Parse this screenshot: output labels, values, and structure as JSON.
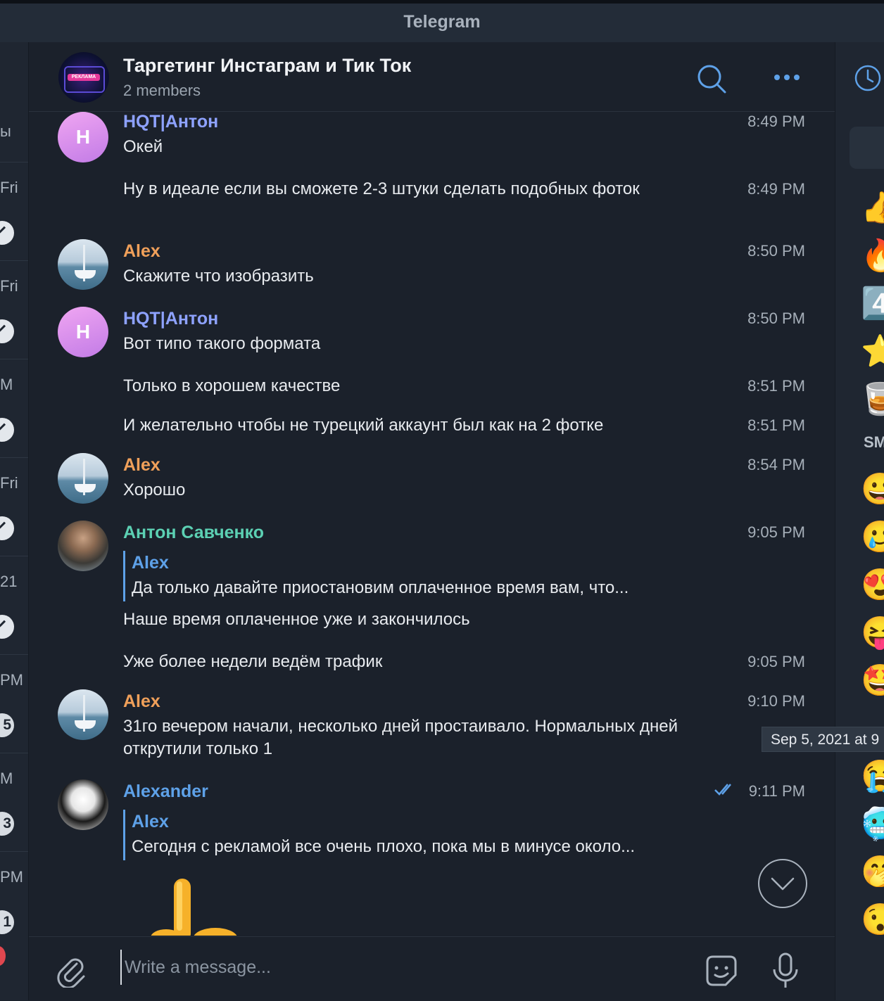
{
  "window": {
    "title": "Telegram"
  },
  "left_column": {
    "items": [
      {
        "text": "ы"
      },
      {
        "text": "Fri"
      },
      {
        "text": "Fri"
      },
      {
        "text": "M"
      },
      {
        "text": "Fri"
      },
      {
        "text": "21"
      },
      {
        "text": "PM"
      },
      {
        "text": "M"
      },
      {
        "text": "PM"
      }
    ],
    "badges": [
      "5",
      "3",
      "1"
    ]
  },
  "header": {
    "title": "Таргетинг Инстаграм и Тик Ток",
    "subtitle": "2 members",
    "avatar_text": "РЕКЛАМА"
  },
  "messages": [
    {
      "sender": "HQT|Антон",
      "sender_color": "#8ea2ff",
      "avatar": "H",
      "text": "Окей",
      "time": "8:49 PM"
    },
    {
      "text": "Ну в идеале если вы сможете 2-3 штуки сделать подобных фоток",
      "time": "8:49 PM"
    },
    {
      "sender": "Alex",
      "sender_color": "#f0a05a",
      "text": "Скажите что изобразить",
      "time": "8:50 PM"
    },
    {
      "sender": "HQT|Антон",
      "sender_color": "#8ea2ff",
      "avatar": "H",
      "text": "Вот типо такого формата",
      "time": "8:50 PM"
    },
    {
      "text": "Только в хорошем качестве",
      "time": "8:51 PM"
    },
    {
      "text": "И желательно чтобы не турецкий аккаунт был как на 2 фотке",
      "time": "8:51 PM"
    },
    {
      "sender": "Alex",
      "sender_color": "#f0a05a",
      "text": "Хорошо",
      "time": "8:54 PM"
    },
    {
      "sender": "Антон Савченко",
      "sender_color": "#5cd0b3",
      "time": "9:05 PM",
      "reply": {
        "name": "Alex",
        "text": "Да только давайте приостановим оплаченное время вам, что..."
      },
      "text": "Наше время оплаченное уже и закончилось"
    },
    {
      "text": "Уже более недели ведём трафик",
      "time": "9:05 PM"
    },
    {
      "sender": "Alex",
      "sender_color": "#f0a05a",
      "text": "31го вечером начали, несколько дней простаивало. Нормальных дней открутили только 1",
      "time": "9:10 PM"
    },
    {
      "sender": "Alexander",
      "sender_color": "#5ea1e8",
      "time": "9:11 PM",
      "reply": {
        "name": "Alex",
        "text": "Сегодня с рекламой все очень плохо, пока мы в минусе около..."
      }
    }
  ],
  "tooltip": "Sep 5, 2021 at 9",
  "right_panel": {
    "label": "SM",
    "emojis": [
      "👍",
      "🔥",
      "4️⃣",
      "⭐",
      "🥃",
      "😀",
      "🥲",
      "😍",
      "😝",
      "🤩",
      "😭",
      "🥶",
      "🤭",
      "😯"
    ]
  },
  "composer": {
    "placeholder": "Write a message..."
  },
  "colors": {
    "accent": "#5ea1e8",
    "background": "#1b212b",
    "titlebar": "#232c38"
  }
}
